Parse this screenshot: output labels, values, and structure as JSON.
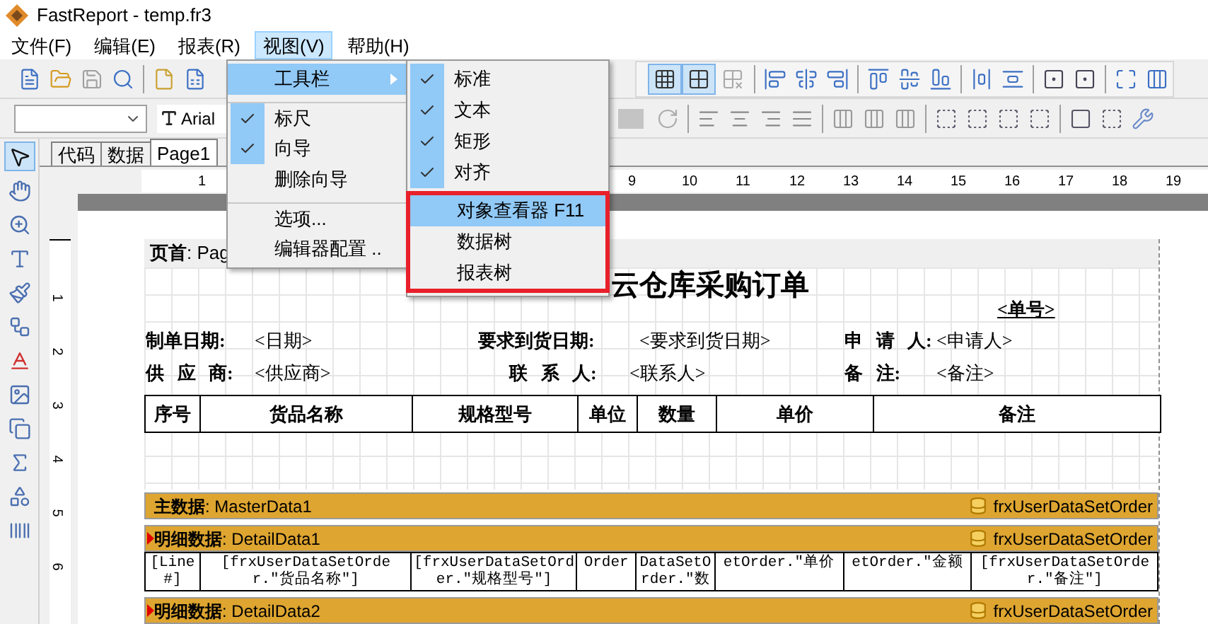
{
  "window": {
    "title": "FastReport - temp.fr3"
  },
  "menu_bar": [
    {
      "label": "文件(F)",
      "selected": false
    },
    {
      "label": "编辑(E)",
      "selected": false
    },
    {
      "label": "报表(R)",
      "selected": false
    },
    {
      "label": "视图(V)",
      "selected": true
    },
    {
      "label": "帮助(H)",
      "selected": false
    }
  ],
  "design_toggles": [
    {
      "kind": "grid",
      "selected": true
    },
    {
      "kind": "snap",
      "selected": true
    },
    {
      "kind": "fit",
      "selected": false
    }
  ],
  "font_toolbar": {
    "font_name": "Arial"
  },
  "tools": [
    {
      "kind": "select",
      "selected": true
    },
    {
      "kind": "hand",
      "selected": false
    },
    {
      "kind": "zoom",
      "selected": false
    },
    {
      "kind": "text",
      "selected": false
    },
    {
      "kind": "brush",
      "selected": false
    },
    {
      "kind": "subreport",
      "selected": false
    },
    {
      "kind": "letter",
      "selected": false
    },
    {
      "kind": "picture",
      "selected": false
    },
    {
      "kind": "copy",
      "selected": false
    },
    {
      "kind": "sum",
      "selected": false
    },
    {
      "kind": "shapes",
      "selected": false
    },
    {
      "kind": "barcode",
      "selected": false
    }
  ],
  "tabs": [
    {
      "label": "代码",
      "selected": false
    },
    {
      "label": "数据",
      "selected": false
    },
    {
      "label": "Page1",
      "selected": true
    }
  ],
  "horizontal_ruler": [
    "1",
    "9",
    "10",
    "11",
    "12",
    "13",
    "14",
    "15",
    "16",
    "17",
    "18",
    "19"
  ],
  "vertical_ruler": [
    "1",
    "2",
    "3",
    "4",
    "5",
    "6"
  ],
  "view_menu": {
    "items": [
      {
        "label": "工具栏",
        "checked": false,
        "selected": true,
        "submenu": true,
        "separator_before": false
      },
      {
        "label": "标尺",
        "checked": true,
        "selected": false,
        "submenu": false,
        "separator_before": true
      },
      {
        "label": "向导",
        "checked": true,
        "selected": false,
        "submenu": false,
        "separator_before": false
      },
      {
        "label": "删除向导",
        "checked": false,
        "selected": false,
        "submenu": false,
        "separator_before": false
      },
      {
        "label": "选项...",
        "checked": false,
        "selected": false,
        "submenu": false,
        "separator_before": true
      },
      {
        "label": "编辑器配置 ..",
        "checked": false,
        "selected": false,
        "submenu": false,
        "separator_before": false
      }
    ]
  },
  "toolbar_submenu": {
    "items": [
      {
        "label": "标准",
        "checked": true,
        "selected": false,
        "highlighted": false
      },
      {
        "label": "文本",
        "checked": true,
        "selected": false,
        "highlighted": false
      },
      {
        "label": "矩形",
        "checked": true,
        "selected": false,
        "highlighted": false
      },
      {
        "label": "对齐",
        "checked": true,
        "selected": false,
        "highlighted": false
      },
      {
        "label": "对象查看器 F11",
        "checked": false,
        "selected": true,
        "highlighted": true
      },
      {
        "label": "数据树",
        "checked": false,
        "selected": false,
        "highlighted": true
      },
      {
        "label": "报表树",
        "checked": false,
        "selected": false,
        "highlighted": true
      }
    ]
  },
  "report": {
    "page_header_band": "**页首**: Pag",
    "title": "云仓库采购订单",
    "order_no": "<单号>",
    "field_rows": [
      [
        {
          "label": "制单日期:",
          "value": "<日期>"
        },
        {
          "label": "要求到货日期:",
          "value": "<要求到货日期>"
        },
        {
          "label": "申 请 人:",
          "value": "<申请人>"
        }
      ],
      [
        {
          "label": "供 应 商:",
          "value": "<供应商>"
        },
        {
          "label": "联 系 人:",
          "value": "<联系人>"
        },
        {
          "label": "备 注:",
          "value": "<备注>"
        }
      ]
    ],
    "table_headers": [
      "序号",
      "货品名称",
      "规格型号",
      "单位",
      "数量",
      "单价",
      "备注"
    ],
    "bands": [
      {
        "label": "**主数据**: MasterData1",
        "dataset": "frxUserDataSetOrder",
        "kind": "master"
      },
      {
        "label": "**明细数据**: DetailData1",
        "dataset": "frxUserDataSetOrder",
        "kind": "detail",
        "cells": [
          "[Line #]",
          "[frxUserDataSetOrder.\"货品名称\"]",
          "[frxUserDataSetOrder.\"规格型号\"]",
          "Order",
          "DataSetOrder.\"数",
          "etOrder.\"单价",
          "etOrder.\"金额",
          "[frxUserDataSetOrder.\"备注\"]"
        ]
      },
      {
        "label": "**明细数据**: DetailData2",
        "dataset": "frxUserDataSetOrder",
        "kind": "detail"
      }
    ]
  }
}
